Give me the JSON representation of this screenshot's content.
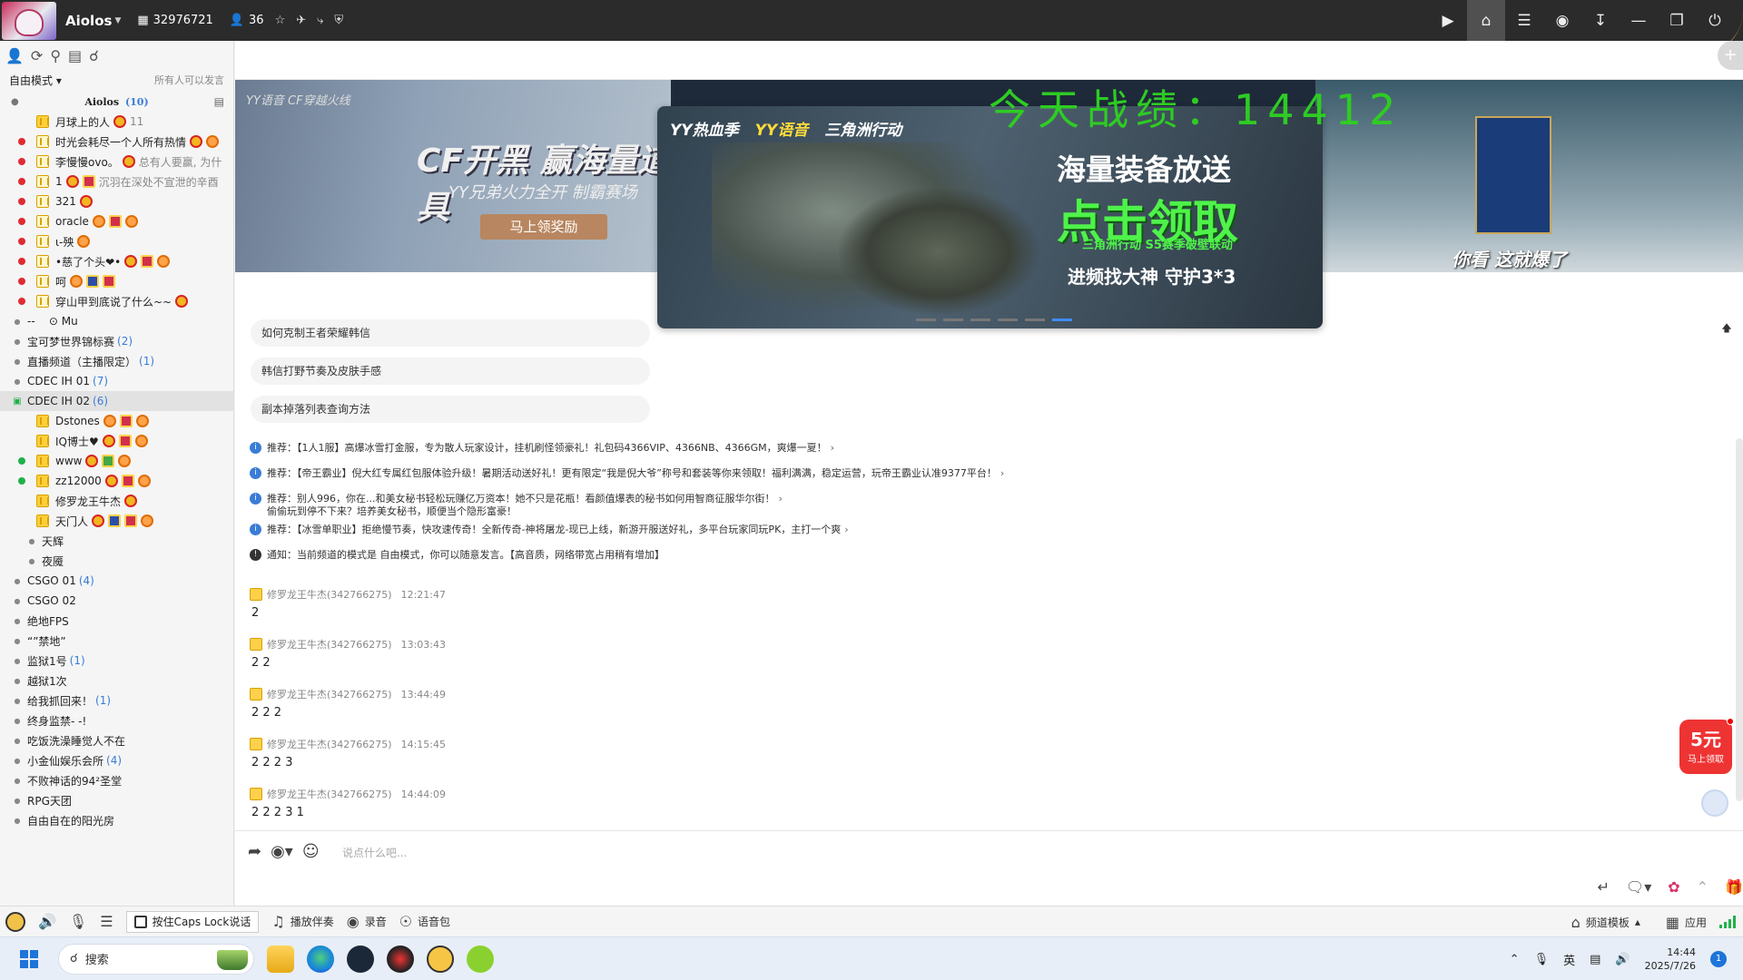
{
  "titlebar": {
    "name": "Aiolos",
    "channel_id": "32976721",
    "online_count": "36",
    "right_icons": [
      "video-icon",
      "home-icon",
      "list-icon",
      "gamepad-icon",
      "minimize-tray-icon",
      "minimize-icon",
      "restore-icon",
      "power-icon"
    ]
  },
  "sidebar": {
    "mode": "自由模式",
    "mode_right": "所有人可以发言",
    "root": {
      "name": "Aiolos",
      "count": "(10)"
    },
    "users": [
      {
        "name": "月球上的人",
        "count": "11",
        "dot": "none",
        "badge": "gold",
        "medals": [
          "medal"
        ]
      },
      {
        "name": "时光会耗尽一个人所有热情",
        "dot": "red",
        "badge": "plain",
        "medals": [
          "medal",
          "orange"
        ]
      },
      {
        "name": "李慢慢ovo。",
        "extra": "总有人要赢, 为什",
        "dot": "red",
        "badge": "plain",
        "medals": [
          "medal"
        ]
      },
      {
        "name": "1",
        "extra": "沉羽在深处不宣泄的辛酉",
        "dot": "red",
        "badge": "plain",
        "medals": [
          "medal",
          "sq"
        ]
      },
      {
        "name": "321",
        "dot": "red",
        "badge": "plain",
        "medals": [
          "medal"
        ]
      },
      {
        "name": "oracle",
        "dot": "red",
        "badge": "plain",
        "medals": [
          "orange",
          "sq",
          "orange"
        ]
      },
      {
        "name": "ι-殃",
        "dot": "red",
        "badge": "plain",
        "medals": [
          "orange"
        ]
      },
      {
        "name": "•慈了个头❤•",
        "dot": "red",
        "badge": "plain",
        "medals": [
          "medal",
          "sq",
          "orange"
        ]
      },
      {
        "name": "呵",
        "dot": "red",
        "badge": "plain",
        "medals": [
          "orange",
          "blue",
          "sq"
        ]
      },
      {
        "name": "穿山甲到底说了什么~~",
        "dot": "red",
        "badge": "plain",
        "medals": [
          "medal"
        ]
      }
    ],
    "channels_a": [
      {
        "name": "--     ⊙ Mu",
        "count": ""
      },
      {
        "name": "宝可梦世界锦标赛",
        "count": "(2)"
      },
      {
        "name": "直播频道（主播限定）",
        "count": "(1)"
      },
      {
        "name": "CDEC IH 01",
        "count": "(7)"
      }
    ],
    "selected_channel": {
      "name": "CDEC IH 02",
      "count": "(6)"
    },
    "users_b": [
      {
        "name": "Dstones",
        "dot": "none",
        "badge": "gold",
        "medals": [
          "orange",
          "sq",
          "orange"
        ]
      },
      {
        "name": "IQ博士♥",
        "dot": "none",
        "badge": "gold",
        "medals": [
          "medal",
          "sq",
          "orange"
        ]
      },
      {
        "name": "www",
        "dot": "green",
        "badge": "gold",
        "medals": [
          "medal",
          "green",
          "orange"
        ]
      },
      {
        "name": "zz12000",
        "dot": "green",
        "badge": "gold",
        "medals": [
          "medal",
          "sq",
          "orange"
        ]
      },
      {
        "name": "修罗龙王牛杰",
        "dot": "none",
        "badge": "gold",
        "medals": [
          "medal"
        ]
      },
      {
        "name": "天门人",
        "dot": "none",
        "badge": "gold",
        "medals": [
          "medal",
          "blue",
          "sq",
          "orange"
        ]
      }
    ],
    "subchannels": [
      "天辉",
      "夜魇"
    ],
    "channels_b": [
      {
        "name": "CSGO 01",
        "count": "(4)"
      },
      {
        "name": "CSGO 02",
        "count": ""
      },
      {
        "name": "绝地FPS",
        "count": ""
      },
      {
        "name": "“”禁地”",
        "count": ""
      },
      {
        "name": "监狱1号",
        "count": "(1)"
      },
      {
        "name": "越狱1次",
        "count": ""
      },
      {
        "name": "给我抓回来！",
        "count": "(1)"
      },
      {
        "name": "终身监禁- -!",
        "count": ""
      },
      {
        "name": "吃饭洗澡睡觉人不在",
        "count": ""
      },
      {
        "name": "小金仙娱乐会所",
        "count": "(4)"
      },
      {
        "name": "不败神话的94²圣堂",
        "count": ""
      },
      {
        "name": "RPG天团",
        "count": ""
      },
      {
        "name": "自由自在的阳光房",
        "count": ""
      }
    ]
  },
  "overlay_text": "今天战绩：14412",
  "banner": {
    "left_tag": "YY语音  CF穿越火线",
    "left_title": "CF开黑 赢海量道具",
    "left_sub": "YY兄弟火力全开 制霸赛场",
    "left_btn": "马上领奖励",
    "center_brand": [
      "YY热血季",
      "YY语音",
      "三角洲行动"
    ],
    "center_h1": "海量装备放送",
    "center_h2": "点击领取",
    "center_h3": "三角洲行动 S5赛季破壁联动",
    "center_h4": "进频找大神 守护3*3",
    "right_text": "你看 这就爆了"
  },
  "suggestions": [
    "如何克制王者荣耀韩信",
    "韩信打野节奏及皮肤手感",
    "副本掉落列表查询方法"
  ],
  "notices": [
    {
      "type": "info",
      "text": "推荐：【1人1服】高爆冰雪打金服，专为散人玩家设计，挂机刷怪领豪礼！礼包码4366VIP、4366NB、4366GM，爽爆一夏！"
    },
    {
      "type": "info",
      "text": "推荐：【帝王霸业】倪大红专属红包服体验升级！暑期活动送好礼！更有限定“我是倪大爷”称号和套装等你来领取！福利满满，稳定运营，玩帝王霸业认准9377平台！"
    },
    {
      "type": "info",
      "text": "推荐：别人996，你在...和美女秘书轻松玩赚亿万资本！她不只是花瓶！看颜值爆表的秘书如何用智商征服华尔街！",
      "text2": "偷偷玩到停不下来？培养美女秘书，顺便当个隐形富豪！"
    },
    {
      "type": "info",
      "text": "推荐：【冰雪单职业】拒绝慢节奏，快攻速传奇！全新传奇-神将屠龙-现已上线，新游开服送好礼，多平台玩家同玩PK，主打一个爽"
    },
    {
      "type": "warn",
      "text": "通知：当前频道的模式是 自由模式，你可以随意发言。【高音质，网络带宽占用稍有增加】"
    }
  ],
  "messages": [
    {
      "user": "修罗龙王牛杰(342766275)",
      "time": "12:21:47",
      "text": "2"
    },
    {
      "user": "修罗龙王牛杰(342766275)",
      "time": "13:03:43",
      "text": "2 2"
    },
    {
      "user": "修罗龙王牛杰(342766275)",
      "time": "13:44:49",
      "text": "2 2 2"
    },
    {
      "user": "修罗龙王牛杰(342766275)",
      "time": "14:15:45",
      "text": "2 2 2 3"
    },
    {
      "user": "修罗龙王牛杰(342766275)",
      "time": "14:44:09",
      "text": "2 2 2 3 1"
    }
  ],
  "promo": {
    "big": "5元",
    "small": "马上领取"
  },
  "composer": {
    "placeholder": "说点什么吧..."
  },
  "bottombar": {
    "ptt_label": "按住Caps Lock说话",
    "play_label": "播放伴奏",
    "record_label": "录音",
    "voicepack_label": "语音包",
    "template_label": "频道模板",
    "apps_label": "应用"
  },
  "taskbar": {
    "search_label": "搜索",
    "ime": "英",
    "time": "14:44",
    "date": "2025/7/26",
    "notification_count": "1"
  }
}
